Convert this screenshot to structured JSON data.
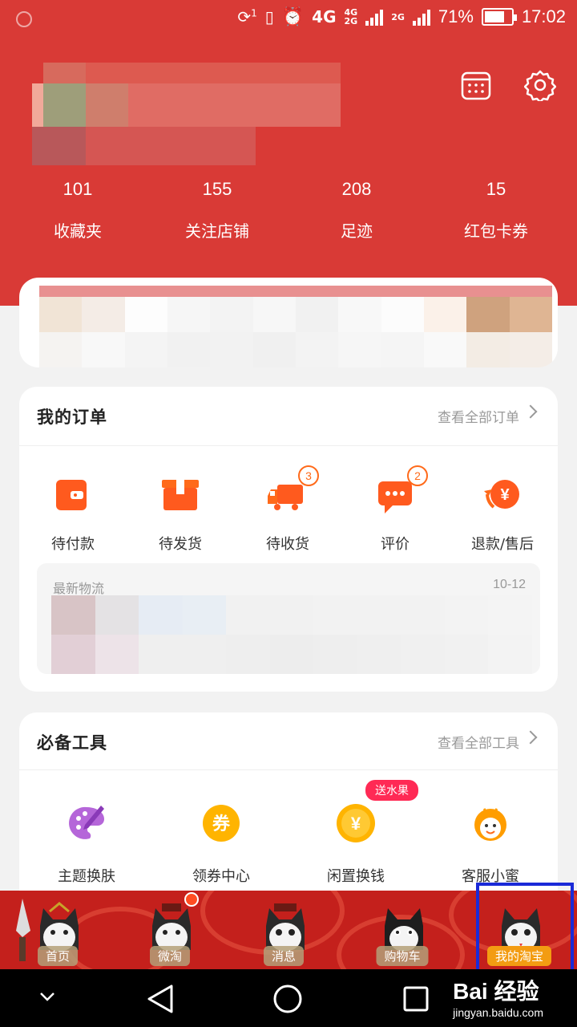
{
  "status_bar": {
    "volte": "1",
    "net1": "4G",
    "net2_top": "4G",
    "net2_bottom": "2G",
    "net3": "2G",
    "battery": "71%",
    "time": "17:02"
  },
  "stats": [
    {
      "value": "101",
      "label": "收藏夹"
    },
    {
      "value": "155",
      "label": "关注店铺"
    },
    {
      "value": "208",
      "label": "足迹"
    },
    {
      "value": "15",
      "label": "红包卡券"
    }
  ],
  "orders": {
    "title": "我的订单",
    "view_all": "查看全部订单",
    "items": [
      {
        "label": "待付款",
        "icon": "wallet-icon",
        "badge": ""
      },
      {
        "label": "待发货",
        "icon": "package-icon",
        "badge": ""
      },
      {
        "label": "待收货",
        "icon": "truck-icon",
        "badge": "3"
      },
      {
        "label": "评价",
        "icon": "comment-icon",
        "badge": "2"
      },
      {
        "label": "退款/售后",
        "icon": "refund-icon",
        "badge": ""
      }
    ],
    "logistics": {
      "title": "最新物流",
      "date": "10-12"
    }
  },
  "tools": {
    "title": "必备工具",
    "view_all": "查看全部工具",
    "items": [
      {
        "label": "主题换肤",
        "icon": "palette-icon"
      },
      {
        "label": "领券中心",
        "icon": "coupon-icon",
        "icon_text": "券"
      },
      {
        "label": "闲置换钱",
        "icon": "yuan-coin-icon",
        "badge": "送水果"
      },
      {
        "label": "客服小蜜",
        "icon": "bee-icon"
      }
    ]
  },
  "tabbar": {
    "tabs": [
      {
        "label": "首页"
      },
      {
        "label": "微淘"
      },
      {
        "label": "消息"
      },
      {
        "label": "购物车"
      },
      {
        "label": "我的淘宝"
      }
    ]
  },
  "watermark": {
    "brand": "Bai 经验",
    "url": "jingyan.baidu.com"
  },
  "colors": {
    "brand_red": "#d93a36",
    "accent_orange": "#ff6a1a",
    "highlight_blue": "#1a2ad8"
  }
}
